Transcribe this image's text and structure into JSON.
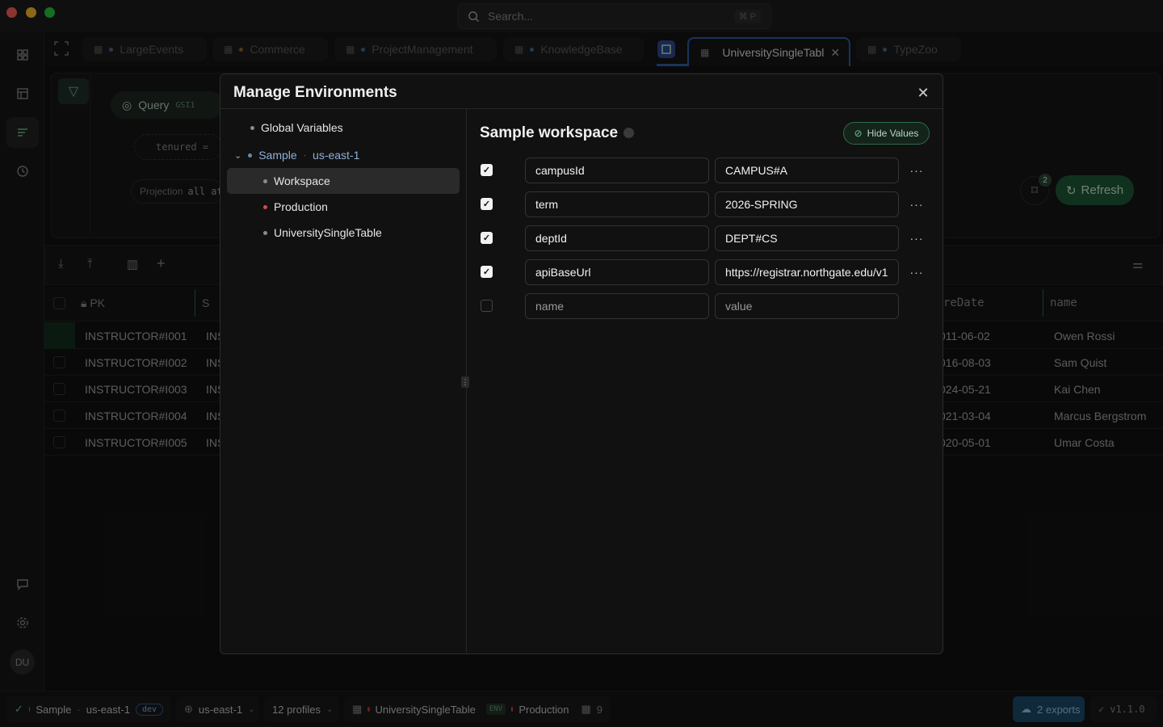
{
  "window": {
    "search_placeholder": "Search...",
    "search_shortcut": "⌘ P"
  },
  "tabs": [
    {
      "label": "LargeEvents",
      "dot": "#4a6a8a"
    },
    {
      "label": "Commerce",
      "dot": "#8a6a2a"
    },
    {
      "label": "ProjectManagement",
      "dot": "#4a6a8a"
    },
    {
      "label": "KnowledgeBase",
      "dot": "#4a6a8a"
    },
    {
      "label": "UniversitySingleTabl",
      "dot": "#c0392b"
    },
    {
      "label": "TypeZoo",
      "dot": "#4a6a8a"
    }
  ],
  "query_panel": {
    "query_label": "Query",
    "index_label": "GSI1",
    "filter_chip": "tenured =",
    "projection_label": "Projection",
    "projection_value": "all at",
    "refresh_label": "Refresh",
    "bookmark_count": "2"
  },
  "table": {
    "pk_header": "PK",
    "sk_header_partial": "S",
    "date_header_partial": "reDate",
    "name_header": "name",
    "rows": [
      {
        "pk": "INSTRUCTOR#I001",
        "sk": "INS",
        "date": "011-06-02",
        "name": "Owen Rossi"
      },
      {
        "pk": "INSTRUCTOR#I002",
        "sk": "INS",
        "date": "016-08-03",
        "name": "Sam Quist"
      },
      {
        "pk": "INSTRUCTOR#I003",
        "sk": "INS",
        "date": "024-05-21",
        "name": "Kai Chen"
      },
      {
        "pk": "INSTRUCTOR#I004",
        "sk": "INS",
        "date": "021-03-04",
        "name": "Marcus Bergstrom"
      },
      {
        "pk": "INSTRUCTOR#I005",
        "sk": "INS",
        "date": "020-05-01",
        "name": "Umar Costa"
      }
    ]
  },
  "modal": {
    "title": "Manage Environments",
    "tree": {
      "global": "Global Variables",
      "sample": "Sample",
      "sample_region": "us-east-1",
      "children": [
        {
          "label": "Workspace",
          "dot": "#8a8a8a"
        },
        {
          "label": "Production",
          "dot": "#d94a4a"
        },
        {
          "label": "UniversitySingleTable",
          "dot": "#8a8a8a"
        }
      ]
    },
    "section_title": "Sample workspace",
    "hide_values_label": "Hide Values",
    "variables": [
      {
        "key": "campusId",
        "value": "CAMPUS#A",
        "checked": true
      },
      {
        "key": "term",
        "value": "2026-SPRING",
        "checked": true
      },
      {
        "key": "deptId",
        "value": "DEPT#CS",
        "checked": true
      },
      {
        "key": "apiBaseUrl",
        "value": "https://registrar.northgate.edu/v1",
        "checked": true
      }
    ],
    "new_key_placeholder": "name",
    "new_value_placeholder": "value"
  },
  "user": {
    "initials": "DU"
  },
  "status": {
    "env_name": "Sample",
    "env_region": "us-east-1",
    "env_badge": "dev",
    "region": "us-east-1",
    "profiles": "12 profiles",
    "table": "UniversitySingleTable",
    "env_tag": "ENV",
    "env_active": "Production",
    "count": "9",
    "exports": "2 exports",
    "version": "v1.1.0"
  },
  "colors": {
    "accent_green": "#3a9a5a",
    "danger": "#d94a4a",
    "info_blue": "#2c5f8a"
  }
}
